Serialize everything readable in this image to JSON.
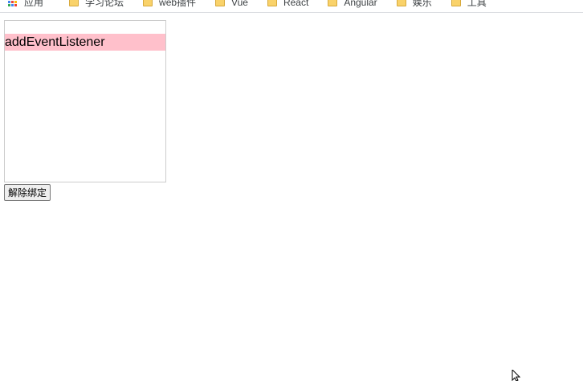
{
  "bookmarks": {
    "items": [
      {
        "label": "应用",
        "icon": "apps-icon"
      },
      {
        "label": "学习论坛",
        "icon": "folder-icon"
      },
      {
        "label": "web插件",
        "icon": "folder-icon"
      },
      {
        "label": "Vue",
        "icon": "folder-icon"
      },
      {
        "label": "React",
        "icon": "folder-icon"
      },
      {
        "label": "Angular",
        "icon": "folder-icon"
      },
      {
        "label": "娱乐",
        "icon": "folder-icon"
      },
      {
        "label": "工具",
        "icon": "folder-icon"
      }
    ]
  },
  "demo": {
    "text": "addEventListener",
    "highlight_color": "#ffc0cb"
  },
  "button": {
    "label": "解除绑定"
  }
}
